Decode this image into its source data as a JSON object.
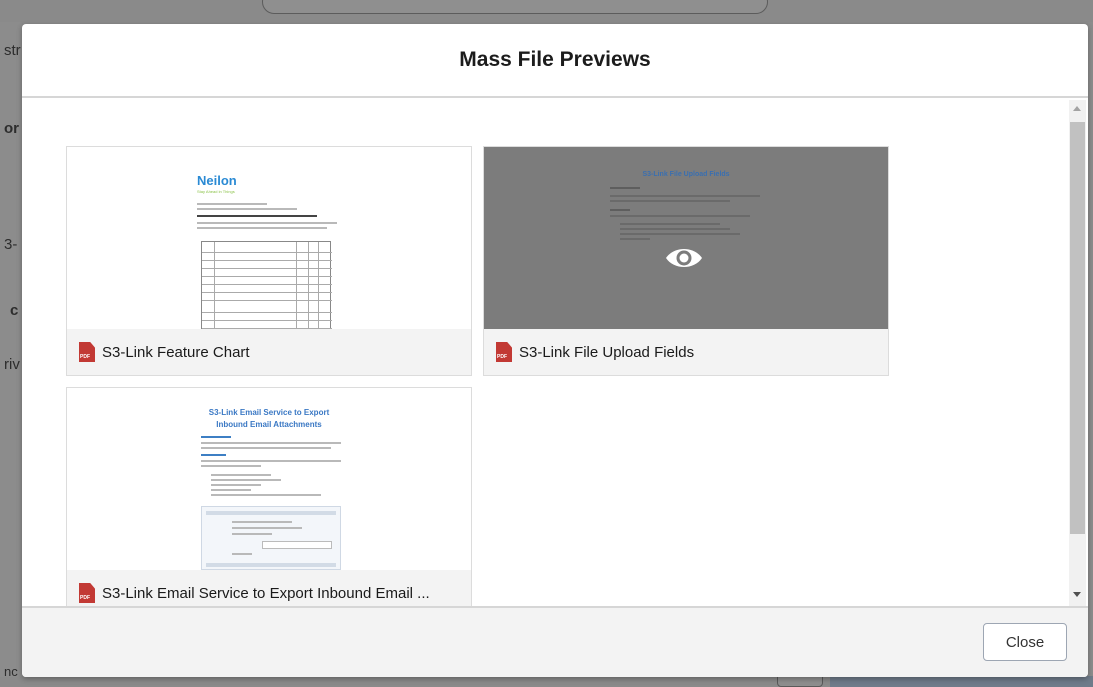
{
  "background": {
    "fragments": [
      "str",
      "or",
      "3-",
      "c",
      "riv",
      "nc"
    ]
  },
  "modal": {
    "title": "Mass File Previews",
    "close_label": "Close"
  },
  "files": [
    {
      "name": "S3-Link Feature Chart",
      "type_badge": "PDF",
      "icon": "pdf-icon",
      "doc": {
        "logo": "Neilon",
        "logo_sub": "Stay Ahead in Things"
      }
    },
    {
      "name": "S3-Link File Upload Fields",
      "type_badge": "PDF",
      "icon": "pdf-icon",
      "preview_overlay_icon": "eye-icon",
      "doc": {
        "title": "S3-Link File Upload Fields"
      }
    },
    {
      "name": "S3-Link Email Service to Export Inbound Email ...",
      "type_badge": "PDF",
      "icon": "pdf-icon",
      "doc": {
        "title_line1": "S3-Link Email Service to Export",
        "title_line2": "Inbound Email Attachments"
      }
    }
  ],
  "colors": {
    "pdf_icon": "#c23934",
    "overlay": "#7c7c7c",
    "link_blue": "#3a78c4"
  }
}
